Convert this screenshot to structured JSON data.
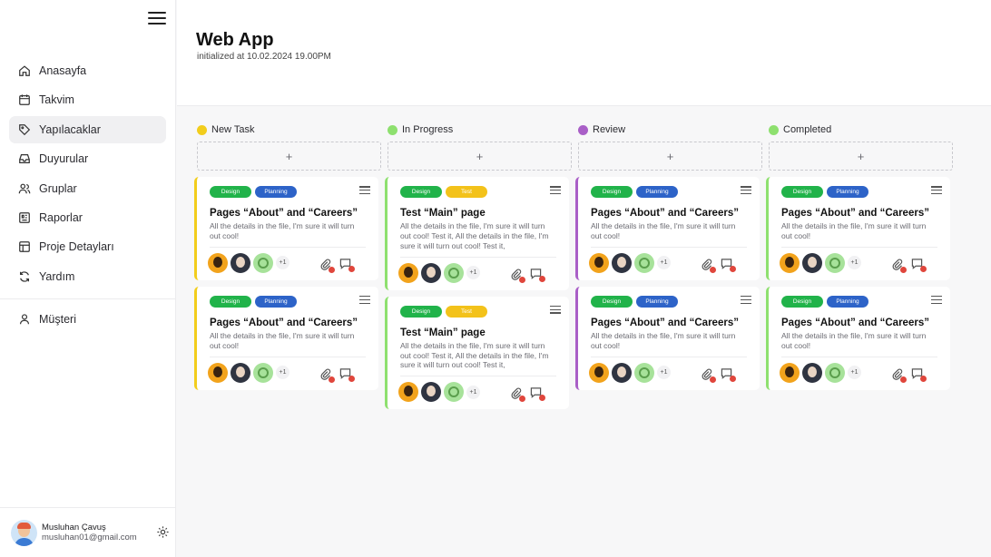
{
  "app": {
    "title": "Web App",
    "subtitle": "initialized at 10.02.2024 19.00PM"
  },
  "sidebar": {
    "items": [
      {
        "label": "Anasayfa",
        "icon": "home-icon"
      },
      {
        "label": "Takvim",
        "icon": "calendar-icon"
      },
      {
        "label": "Yapılacaklar",
        "icon": "tag-icon",
        "active": true
      },
      {
        "label": "Duyurular",
        "icon": "inbox-icon"
      },
      {
        "label": "Gruplar",
        "icon": "users-icon"
      },
      {
        "label": "Raporlar",
        "icon": "report-icon"
      },
      {
        "label": "Proje Detayları",
        "icon": "table-icon"
      },
      {
        "label": "Yardım",
        "icon": "refresh-icon"
      }
    ],
    "secondary": [
      {
        "label": "Müşteri",
        "icon": "user-icon"
      }
    ],
    "profile": {
      "name": "Musluhan Çavuş",
      "email": "musluhan01@gmail.com"
    }
  },
  "board": {
    "add_label": "+",
    "columns": [
      {
        "title": "New Task",
        "color": "#f2cd1c",
        "cards": [
          {
            "tags": [
              "Design",
              "Planning"
            ],
            "title": "Pages “About” and “Careers”",
            "desc": "All the details in the file, I'm sure it will turn out cool!",
            "extra": "+1"
          },
          {
            "tags": [
              "Design",
              "Planning"
            ],
            "title": "Pages “About” and “Careers”",
            "desc": "All the details in the file, I'm sure it will turn out cool!",
            "extra": "+1"
          }
        ]
      },
      {
        "title": "In Progress",
        "color": "#8ee06f",
        "cards": [
          {
            "tags": [
              "Design",
              "Test"
            ],
            "title": "Test “Main” page",
            "desc": "All the details in the file, I'm sure it will turn out cool! Test it, All the details in the file, I'm sure it will turn out cool! Test it,",
            "extra": "+1"
          },
          {
            "tags": [
              "Design",
              "Test"
            ],
            "title": "Test “Main” page",
            "desc": "All the details in the file, I'm sure it will turn out cool! Test it, All the details in the file, I'm sure it will turn out cool! Test it,",
            "extra": "+1"
          }
        ]
      },
      {
        "title": "Review",
        "color": "#a95fc7",
        "cards": [
          {
            "tags": [
              "Design",
              "Planning"
            ],
            "title": "Pages “About” and “Careers”",
            "desc": "All the details in the file, I'm sure it will turn out cool!",
            "extra": "+1"
          },
          {
            "tags": [
              "Design",
              "Planning"
            ],
            "title": "Pages “About” and “Careers”",
            "desc": "All the details in the file, I'm sure it will turn out cool!",
            "extra": "+1"
          }
        ]
      },
      {
        "title": "Completed",
        "color": "#8ee06f",
        "cards": [
          {
            "tags": [
              "Design",
              "Planning"
            ],
            "title": "Pages “About” and “Careers”",
            "desc": "All the details in the file, I'm sure it will turn out cool!",
            "extra": "+1"
          },
          {
            "tags": [
              "Design",
              "Planning"
            ],
            "title": "Pages “About” and “Careers”",
            "desc": "All the details in the file, I'm sure it will turn out cool!",
            "extra": "+1"
          }
        ]
      }
    ]
  }
}
